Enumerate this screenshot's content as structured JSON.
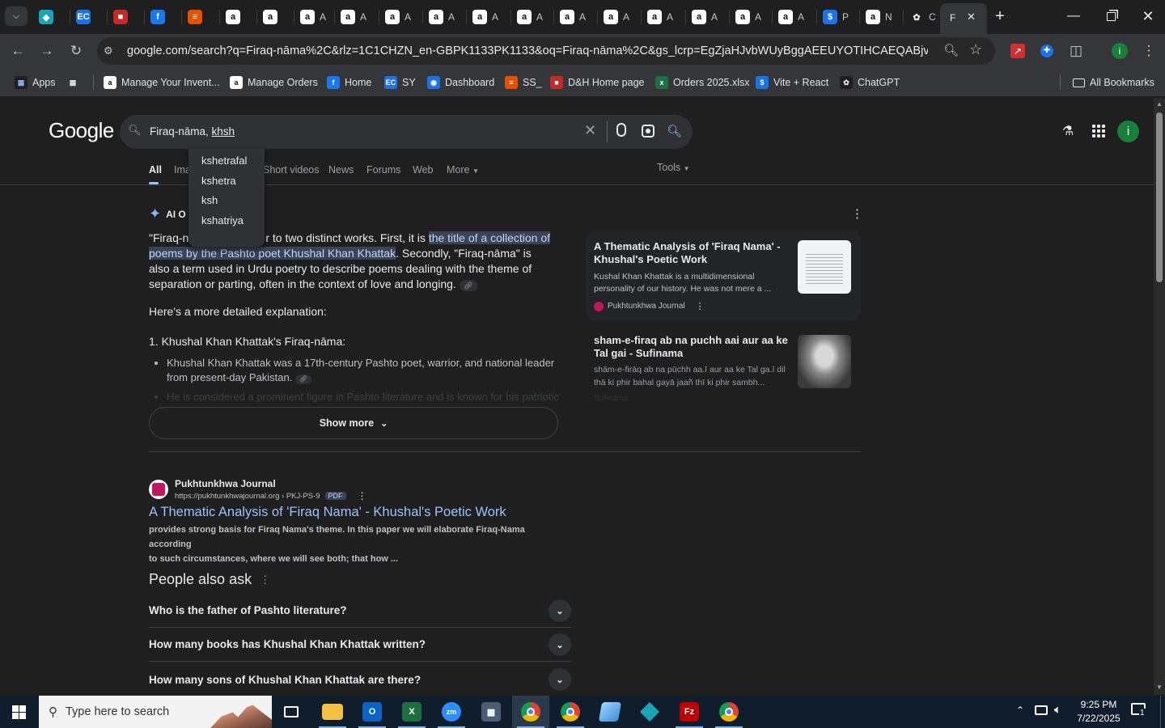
{
  "browser": {
    "tabs": [
      {
        "icon": "teal-app-icon",
        "label": ""
      },
      {
        "icon": "ec-icon",
        "label": ""
      },
      {
        "icon": "red-app-icon",
        "label": ""
      },
      {
        "icon": "facebook-icon",
        "label": ""
      },
      {
        "icon": "stack-icon",
        "label": ""
      },
      {
        "icon": "amazon-icon",
        "label": ""
      },
      {
        "icon": "amazon-icon",
        "label": ""
      },
      {
        "icon": "amazon-icon",
        "label": "A"
      },
      {
        "icon": "amazon-icon",
        "label": "A"
      },
      {
        "icon": "amazon-icon",
        "label": "A"
      },
      {
        "icon": "amazon-icon",
        "label": "A"
      },
      {
        "icon": "amazon-icon",
        "label": "A"
      },
      {
        "icon": "amazon-icon",
        "label": "A"
      },
      {
        "icon": "amazon-icon",
        "label": "A"
      },
      {
        "icon": "amazon-icon",
        "label": "A"
      },
      {
        "icon": "amazon-icon",
        "label": "A"
      },
      {
        "icon": "amazon-icon",
        "label": "A"
      },
      {
        "icon": "amazon-icon",
        "label": "A"
      },
      {
        "icon": "amazon-icon",
        "label": "A"
      },
      {
        "icon": "dollar-icon",
        "label": "P"
      },
      {
        "icon": "amazon-icon",
        "label": "N"
      },
      {
        "icon": "openai-icon",
        "label": "C"
      }
    ],
    "active_tab_label": "F",
    "url": "google.com/search?q=Firaq-nāma%2C&rlz=1C1CHZN_en-GBPK1133PK1133&oq=Firaq-nāma%2C&gs_lcrp=EgZjaHJvbWUyBggAEEUYOTIHCAEQABjvBTIKCAIQ..."
  },
  "bookmarks": [
    {
      "label": "Apps",
      "icon": "apps-grid-icon"
    },
    {
      "label": "",
      "icon": "tab-groups-icon"
    },
    {
      "label": "Manage Your Invent...",
      "icon": "amazon-icon"
    },
    {
      "label": "Manage Orders",
      "icon": "amazon-icon"
    },
    {
      "label": "Home",
      "icon": "facebook-icon"
    },
    {
      "label": "SY",
      "icon": "ec-icon"
    },
    {
      "label": "Dashboard",
      "icon": "dashboard-icon"
    },
    {
      "label": "SS_",
      "icon": "stack-icon"
    },
    {
      "label": "D&H Home page",
      "icon": "dh-icon"
    },
    {
      "label": "Orders 2025.xlsx",
      "icon": "excel-icon"
    },
    {
      "label": "Vite + React",
      "icon": "dollar-icon"
    },
    {
      "label": "ChatGPT",
      "icon": "openai-icon"
    }
  ],
  "all_bookmarks_label": "All Bookmarks",
  "google": {
    "logo": "Google",
    "query": "Firaq-nāma, khsh",
    "query_typed_prefix": "Firaq-nāma, ",
    "query_typed_suffix": "khsh",
    "suggestions": [
      "kshetrafal",
      "kshetra",
      "ksh",
      "kshatriya"
    ],
    "nav_tabs": [
      "All",
      "Ima",
      "Short videos",
      "News",
      "Forums",
      "Web",
      "More"
    ],
    "tools_label": "Tools",
    "avatar_letter": "i",
    "ai_overview": {
      "label": "AI O",
      "p1_a": "\"Firaq-n",
      "p1_b": "r to two distinct works. First, it is ",
      "p1_hl1": "the title of a collection of",
      "p1_hl2": "poems by the Pashto poet Khushal Khan Khattak",
      "p1_c": ". Secondly, \"Firaq-nāma\" is",
      "p1_d": "also a term used in Urdu poetry to describe poems dealing with the theme of",
      "p1_e": "separation or parting, often in the context of love and longing.",
      "p2": "Here's a more detailed explanation:",
      "h1": "1. Khushal Khan Khattak's Firaq-nāma:",
      "bullet1_a": "Khushal Khan Khattak was a 17th-century Pashto poet, warrior, and national leader",
      "bullet1_b": "from present-day Pakistan.",
      "bullet2": "He is considered a prominent figure in Pashto literature and is known for his patriotic",
      "show_more": "Show more"
    },
    "ai_sources": [
      {
        "title": "A Thematic Analysis of 'Firaq Nama' - Khushal's Poetic Work",
        "snippet": "Kushal Khan Khattak is a multidimensional personality of our history. He was not mere a ...",
        "source": "Pukhtunkhwa Journal"
      },
      {
        "title": "sham-e-firaq ab na puchh aai aur aa ke Tal gai - Sufinama",
        "snippet": "shām-e-firāq ab na pūchh aa.ī aur aa ke Tal ga.ī dil thā ki phir bahal gayā jaañ thī ki phir sambh...",
        "source": "Sufinama"
      }
    ],
    "result": {
      "site": "Pukhtunkhwa Journal",
      "cite": "https://pukhtunkhwajournal.org › PKJ-PS-9",
      "badge": "PDF",
      "title": "A Thematic Analysis of 'Firaq Nama' - Khushal's Poetic Work",
      "snippet_a": "provides strong basis for Firaq Nama's theme.",
      "snippet_b": " In this paper we will elaborate Firaq-Nama according",
      "snippet_c": "to such circumstances, where we will see both; that how ..."
    },
    "paa_title": "People also ask",
    "paa": [
      "Who is the father of Pashto literature?",
      "How many books has Khushal Khan Khattak written?",
      "How many sons of Khushal Khan Khattak are there?"
    ]
  },
  "taskbar": {
    "search_placeholder": "Type here to search",
    "time": "9:25 PM",
    "date": "7/22/2025",
    "notification_count": "1"
  }
}
